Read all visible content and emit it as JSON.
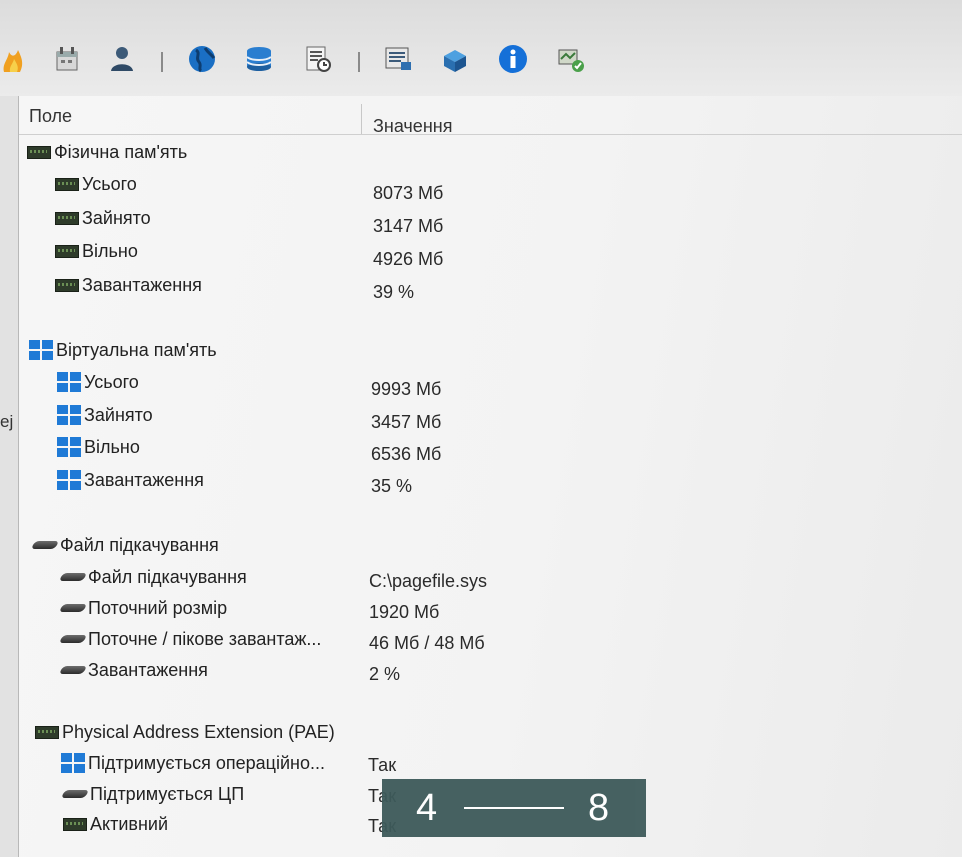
{
  "toolbar": {
    "icons": [
      "flame-icon",
      "calendar-icon",
      "user-icon",
      "globe-icon",
      "database-icon",
      "report-icon",
      "monitor-report-icon",
      "network-icon",
      "info-icon",
      "network-check-icon"
    ]
  },
  "left_strip": {
    "fragment": "еј"
  },
  "header": {
    "field": "Поле",
    "value": "Значення"
  },
  "sections": {
    "physical": {
      "title": "Фізична пам'ять",
      "rows": [
        {
          "label": "Усього",
          "value": "8073 Мб"
        },
        {
          "label": "Зайнято",
          "value": "3147 Мб"
        },
        {
          "label": "Вільно",
          "value": "4926 Мб"
        },
        {
          "label": "Завантаження",
          "value": "39 %"
        }
      ]
    },
    "virtual": {
      "title": "Віртуальна пам'ять",
      "rows": [
        {
          "label": "Усього",
          "value": "9993 Мб"
        },
        {
          "label": "Зайнято",
          "value": "3457 Мб"
        },
        {
          "label": "Вільно",
          "value": "6536 Мб"
        },
        {
          "label": "Завантаження",
          "value": "35 %"
        }
      ]
    },
    "pagefile": {
      "title": "Файл підкачування",
      "rows": [
        {
          "label": "Файл підкачування",
          "value": "C:\\pagefile.sys"
        },
        {
          "label": "Поточний розмір",
          "value": "1920 Мб"
        },
        {
          "label": "Поточне / пікове завантаж...",
          "value": "46 Мб / 48 Мб"
        },
        {
          "label": "Завантаження",
          "value": "2 %"
        }
      ]
    },
    "pae": {
      "title": "Physical Address Extension (PAE)",
      "rows": [
        {
          "label": "Підтримується операційно...",
          "value": "Так"
        },
        {
          "label": "Підтримується ЦП",
          "value": "Так"
        },
        {
          "label": "Активний",
          "value": "Так"
        }
      ]
    }
  },
  "overlay": {
    "from": "4",
    "to": "8"
  }
}
